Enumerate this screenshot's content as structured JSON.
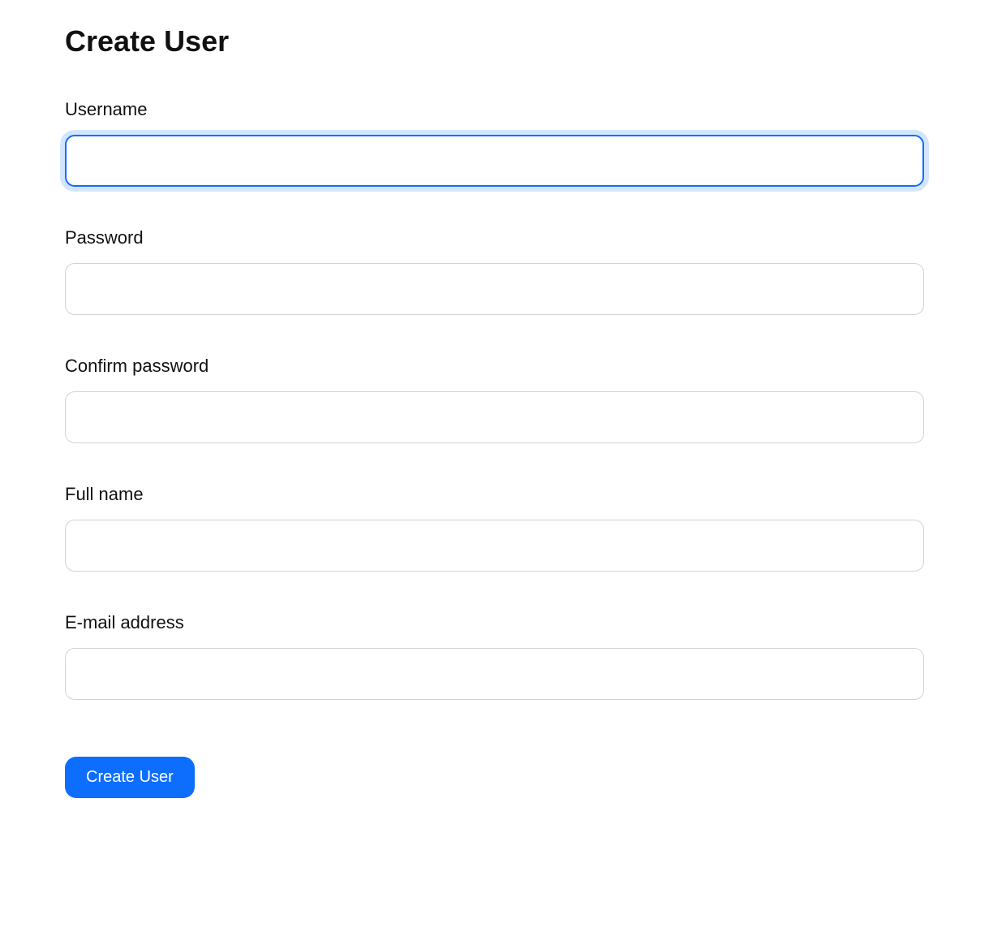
{
  "page": {
    "title": "Create User"
  },
  "form": {
    "fields": {
      "username": {
        "label": "Username",
        "value": ""
      },
      "password": {
        "label": "Password",
        "value": ""
      },
      "confirm_password": {
        "label": "Confirm password",
        "value": ""
      },
      "full_name": {
        "label": "Full name",
        "value": ""
      },
      "email": {
        "label": "E-mail address",
        "value": ""
      }
    },
    "submit_label": "Create User"
  }
}
